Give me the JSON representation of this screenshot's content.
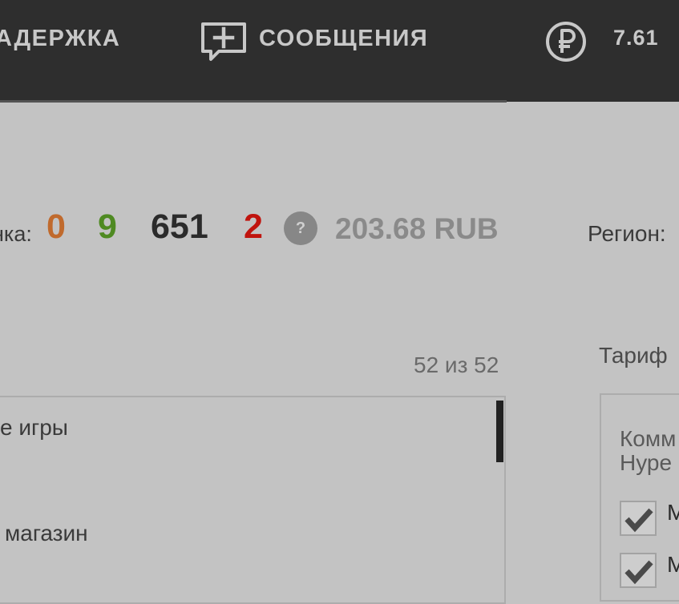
{
  "header": {
    "nav_support": "АДЕРЖКА",
    "nav_messages": "СООБЩЕНИЯ",
    "messages_icon": "chat-plus-icon",
    "currency_icon": "ruble-icon",
    "balance": "7.61"
  },
  "stats": {
    "label": "нка:",
    "orange": "0",
    "green": "9",
    "dark": "651",
    "red": "2",
    "help_icon": "?",
    "amount": "203.68 RUB",
    "region_label": "Регион:",
    "colors": {
      "orange": "#c06a2d",
      "green": "#4f8a22",
      "red": "#c0140e"
    }
  },
  "list": {
    "counter": "52 из 52",
    "items": [
      "е игры",
      "магазин"
    ]
  },
  "tariff": {
    "label": "Тариф",
    "description": "Комм\nНуре",
    "options": [
      "М",
      "М"
    ]
  }
}
